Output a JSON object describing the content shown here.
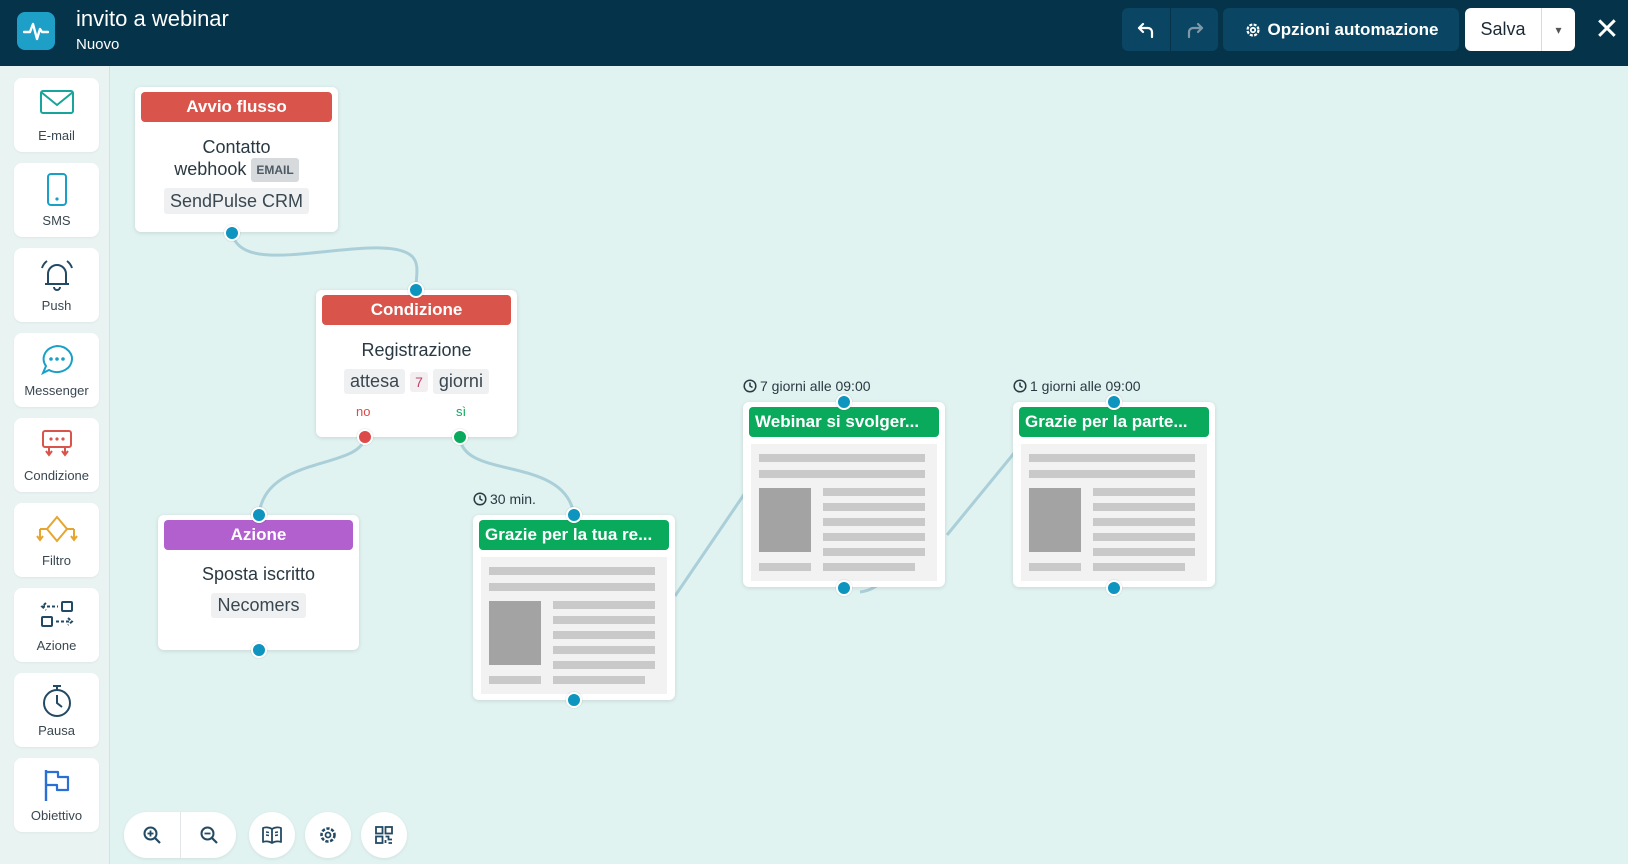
{
  "header": {
    "title": "invito a webinar",
    "subtitle": "Nuovo",
    "options_label": "Opzioni automazione",
    "save_label": "Salva"
  },
  "sidebar": {
    "items": [
      {
        "label": "E-mail",
        "icon": "envelope-icon"
      },
      {
        "label": "SMS",
        "icon": "phone-icon"
      },
      {
        "label": "Push",
        "icon": "bell-icon"
      },
      {
        "label": "Messenger",
        "icon": "chat-bubble-icon"
      },
      {
        "label": "Condizione",
        "icon": "condition-icon"
      },
      {
        "label": "Filtro",
        "icon": "filter-icon"
      },
      {
        "label": "Azione",
        "icon": "action-icon"
      },
      {
        "label": "Pausa",
        "icon": "stopwatch-icon"
      },
      {
        "label": "Obiettivo",
        "icon": "flag-icon"
      }
    ]
  },
  "nodes": {
    "start": {
      "header": "Avvio flusso",
      "line1": "Contatto",
      "line2": "webhook",
      "badge": "EMAIL",
      "chip": "SendPulse CRM"
    },
    "condition": {
      "header": "Condizione",
      "title": "Registrazione",
      "chip1": "attesa",
      "number": "7",
      "chip2": "giorni",
      "no_label": "no",
      "yes_label": "sì"
    },
    "action": {
      "header": "Azione",
      "title": "Sposta iscritto",
      "chip": "Necomers"
    },
    "email1": {
      "timing": "30 min.",
      "header": "Grazie per la tua re..."
    },
    "email2": {
      "timing": "7 giorni alle 09:00",
      "header": "Webinar si svolger..."
    },
    "email3": {
      "timing": "1 giorni alle 09:00",
      "header": "Grazie per la parte..."
    }
  },
  "colors": {
    "header_bg": "#05334a",
    "canvas_bg": "#e1f3f1",
    "start_red": "#d9554b",
    "action_purple": "#b160ce",
    "email_green": "#0aaa5d",
    "port_blue": "#0e95bf"
  }
}
